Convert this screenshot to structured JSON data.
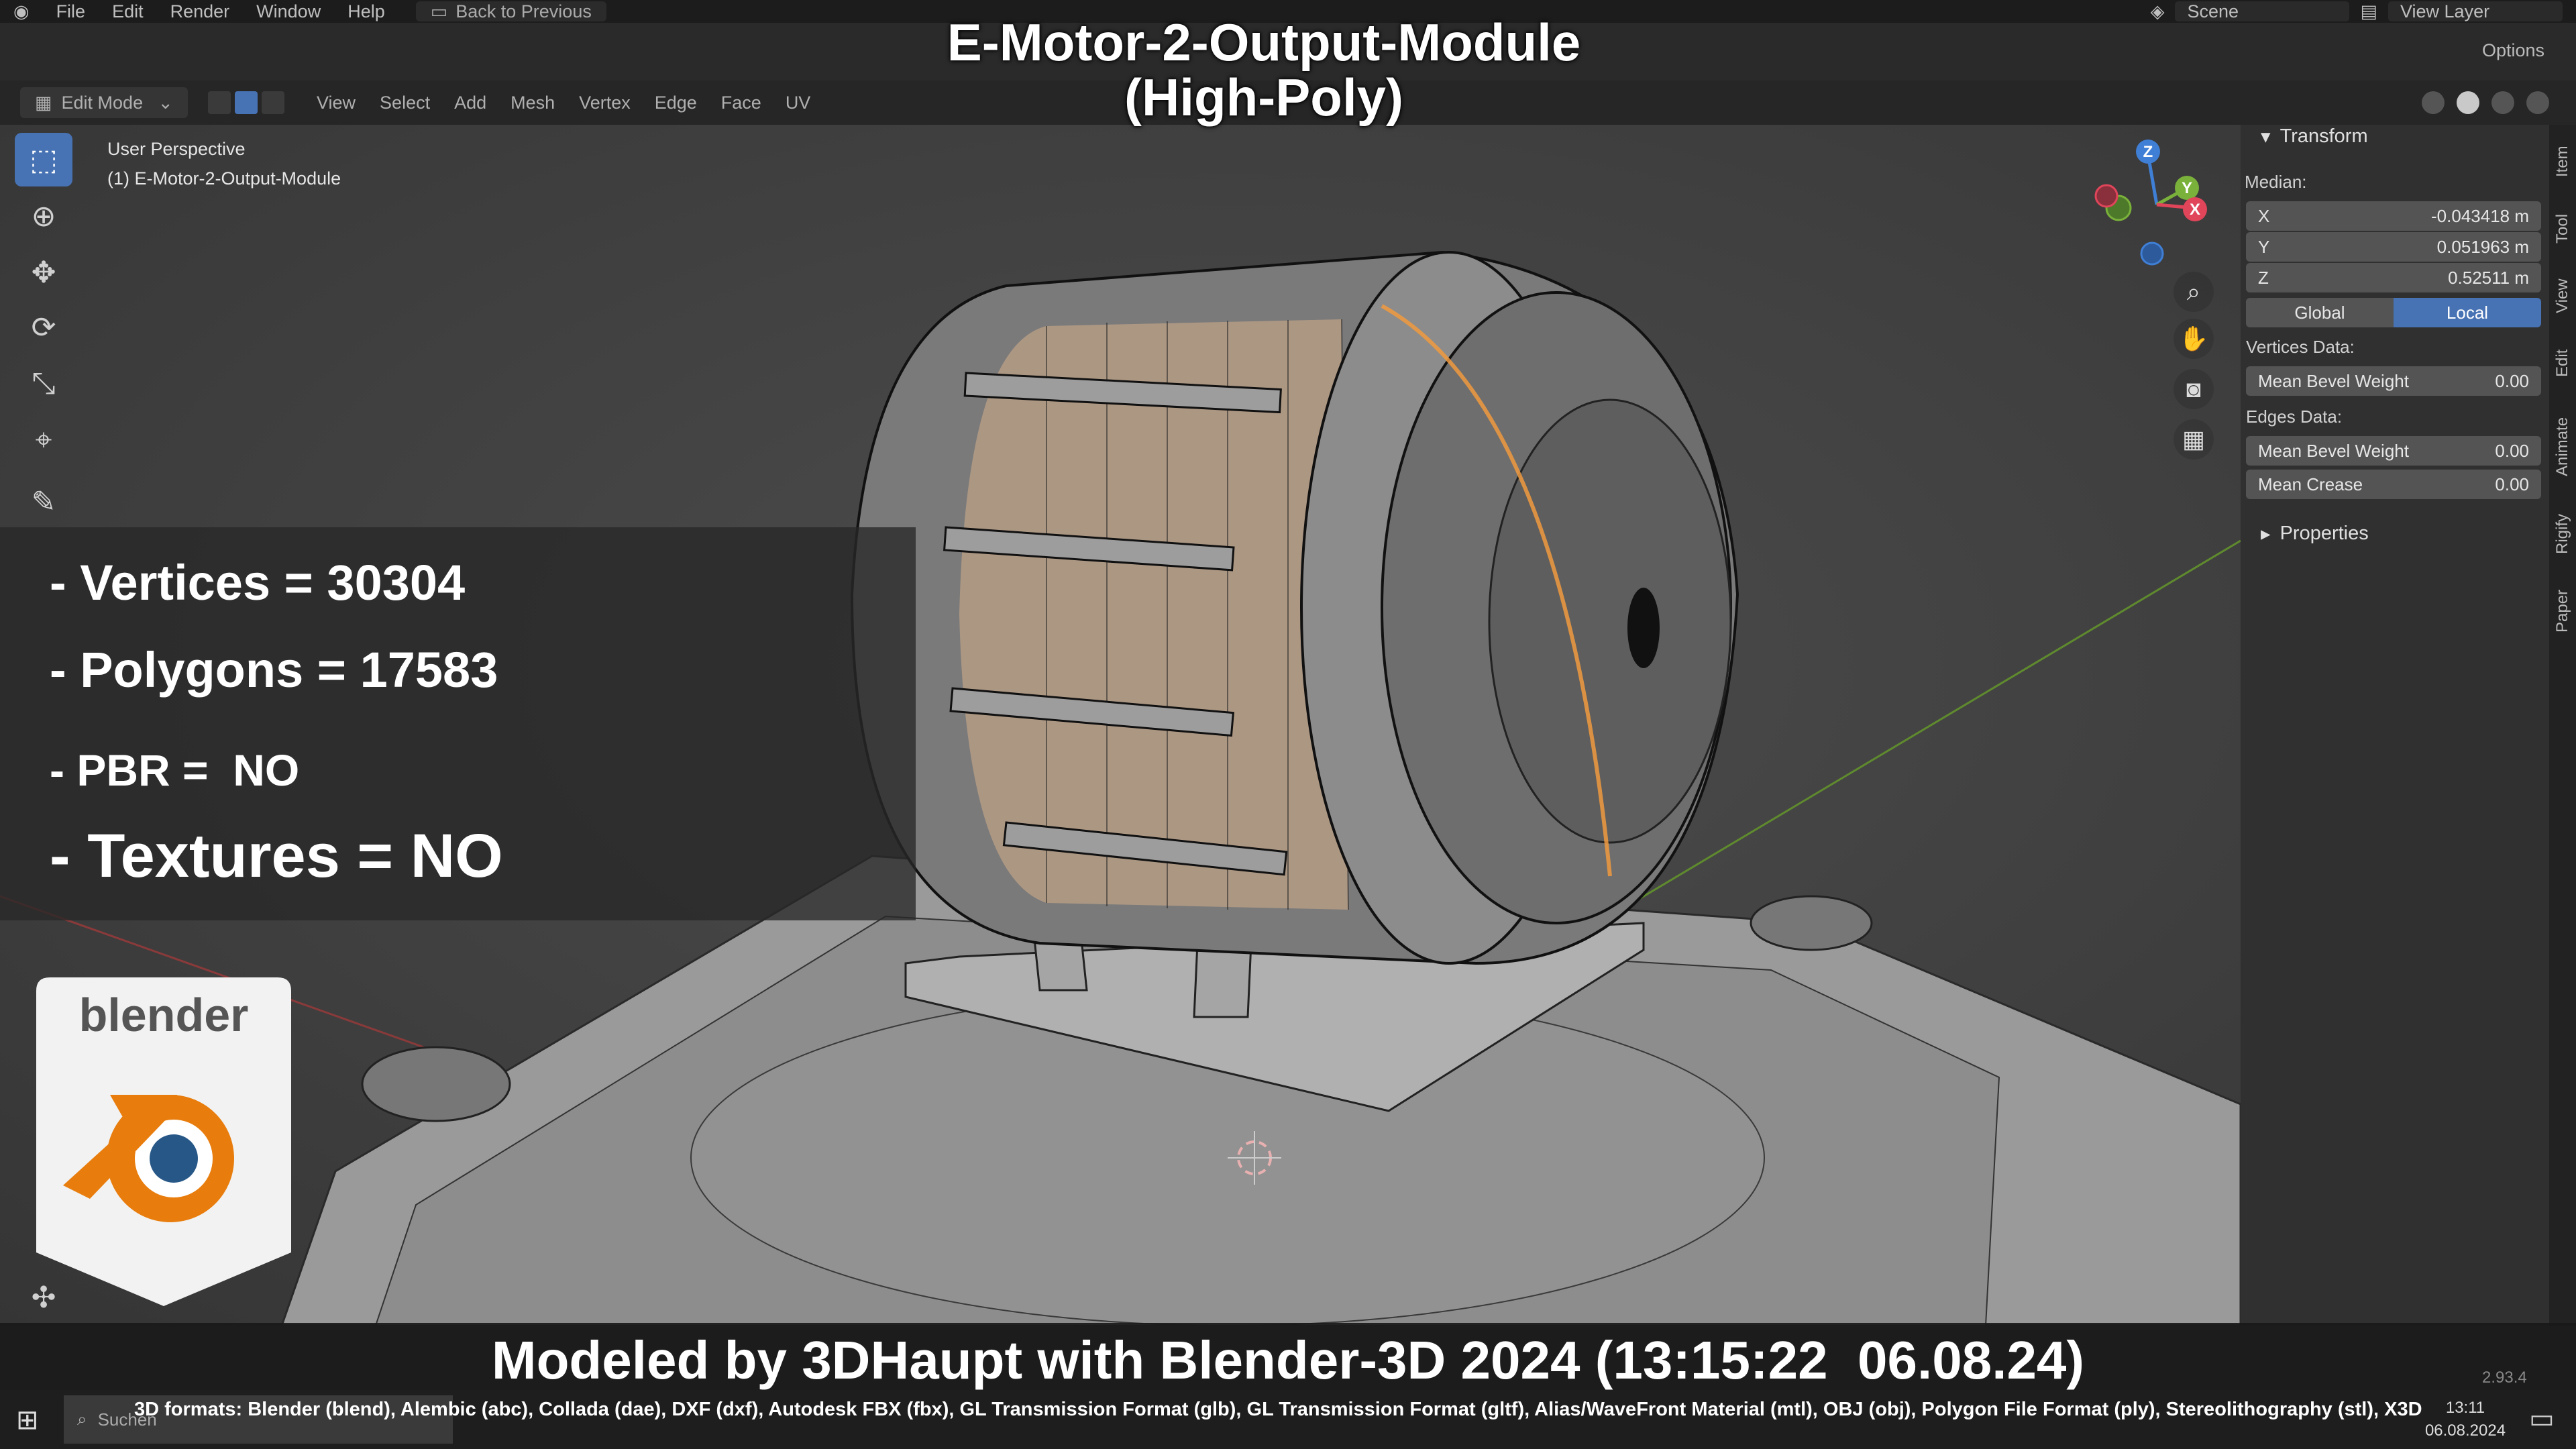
{
  "menu": {
    "items": [
      "File",
      "Edit",
      "Render",
      "Window",
      "Help"
    ],
    "back_label": "Back to Previous",
    "scene_label": "Scene",
    "view_layer_label": "View Layer",
    "options_label": "Options"
  },
  "header": {
    "mode": "Edit Mode",
    "menus": [
      "View",
      "Select",
      "Add",
      "Mesh",
      "Vertex",
      "Edge",
      "Face",
      "UV"
    ]
  },
  "viewport": {
    "perspective": "User Perspective",
    "object": "(1) E-Motor-2-Output-Module"
  },
  "gizmo": {
    "z": "Z",
    "y": "Y",
    "x": "X"
  },
  "npanel": {
    "transform_title": "Transform",
    "median_label": "Median:",
    "x_label": "X",
    "x_value": "-0.043418 m",
    "y_label": "Y",
    "y_value": "0.051963 m",
    "z_label": "Z",
    "z_value": "0.52511 m",
    "global_label": "Global",
    "local_label": "Local",
    "vertices_data_label": "Vertices Data:",
    "v_bevel_label": "Mean Bevel Weight",
    "v_bevel_value": "0.00",
    "edges_data_label": "Edges Data:",
    "e_bevel_label": "Mean Bevel Weight",
    "e_bevel_value": "0.00",
    "e_crease_label": "Mean Crease",
    "e_crease_value": "0.00",
    "properties_title": "Properties",
    "tabs": [
      "Item",
      "Tool",
      "View",
      "Edit",
      "Animate",
      "Rigify",
      "Paper"
    ]
  },
  "overlay": {
    "title_line1": "E-Motor-2-Output-Module",
    "title_line2": "(High-Poly)",
    "vertices": "- Vertices = 30304",
    "polygons": "- Polygons = 17583",
    "pbr": "- PBR =  NO",
    "textures": "- Textures = NO",
    "logo_text": "blender",
    "footer": "Modeled by 3DHaupt with Blender-3D 2024 (13:15:22  06.08.24)",
    "formats": "3D formats: Blender (blend), Alembic (abc), Collada (dae), DXF (dxf), Autodesk FBX (fbx), GL Transmission Format (glb), GL Transmission Format (gltf), Alias/WaveFront Material (mtl), OBJ (obj), Polygon File Format (ply), Stereolithography (stl), X3D"
  },
  "taskbar": {
    "search_placeholder": "Suchen",
    "time": "13:11",
    "date": "06.08.2024",
    "version": "2.93.4"
  },
  "colors": {
    "accent": "#4772b3",
    "selection": "#f09a3e",
    "x_axis": "#e0455a",
    "y_axis": "#7ab13b",
    "z_axis": "#3f7fd6"
  }
}
